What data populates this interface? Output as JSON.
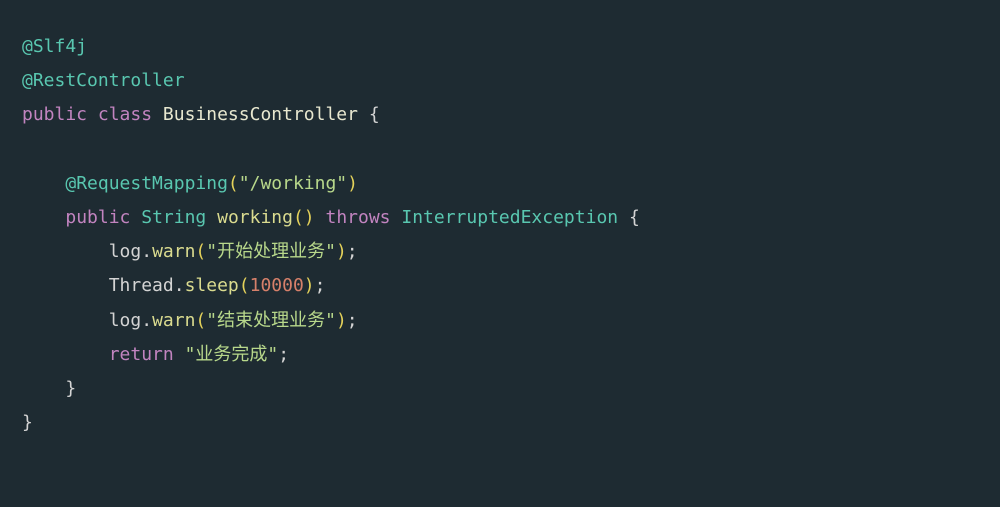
{
  "code": {
    "line1": {
      "annotation": "@Slf4j"
    },
    "line2": {
      "annotation": "@RestController"
    },
    "line3": {
      "kw_public": "public",
      "kw_class": "class",
      "classname": "BusinessController",
      "brace": " {"
    },
    "line5": {
      "indent": "    ",
      "annotation": "@RequestMapping",
      "paren_open": "(",
      "string": "\"/working\"",
      "paren_close": ")"
    },
    "line6": {
      "indent": "    ",
      "kw_public": "public",
      "type": "String",
      "method": "working",
      "parens": "()",
      "kw_throws": "throws",
      "exception": "InterruptedException",
      "brace": " {"
    },
    "line7": {
      "indent": "        ",
      "obj": "log",
      "dot": ".",
      "method": "warn",
      "paren_open": "(",
      "string": "\"开始处理业务\"",
      "paren_close": ")",
      "semi": ";"
    },
    "line8": {
      "indent": "        ",
      "obj": "Thread",
      "dot": ".",
      "method": "sleep",
      "paren_open": "(",
      "number": "10000",
      "paren_close": ")",
      "semi": ";"
    },
    "line9": {
      "indent": "        ",
      "obj": "log",
      "dot": ".",
      "method": "warn",
      "paren_open": "(",
      "string": "\"结束处理业务\"",
      "paren_close": ")",
      "semi": ";"
    },
    "line10": {
      "indent": "        ",
      "kw_return": "return",
      "space": " ",
      "string": "\"业务完成\"",
      "semi": ";"
    },
    "line11": {
      "indent": "    ",
      "brace": "}"
    },
    "line12": {
      "brace": "}"
    }
  }
}
